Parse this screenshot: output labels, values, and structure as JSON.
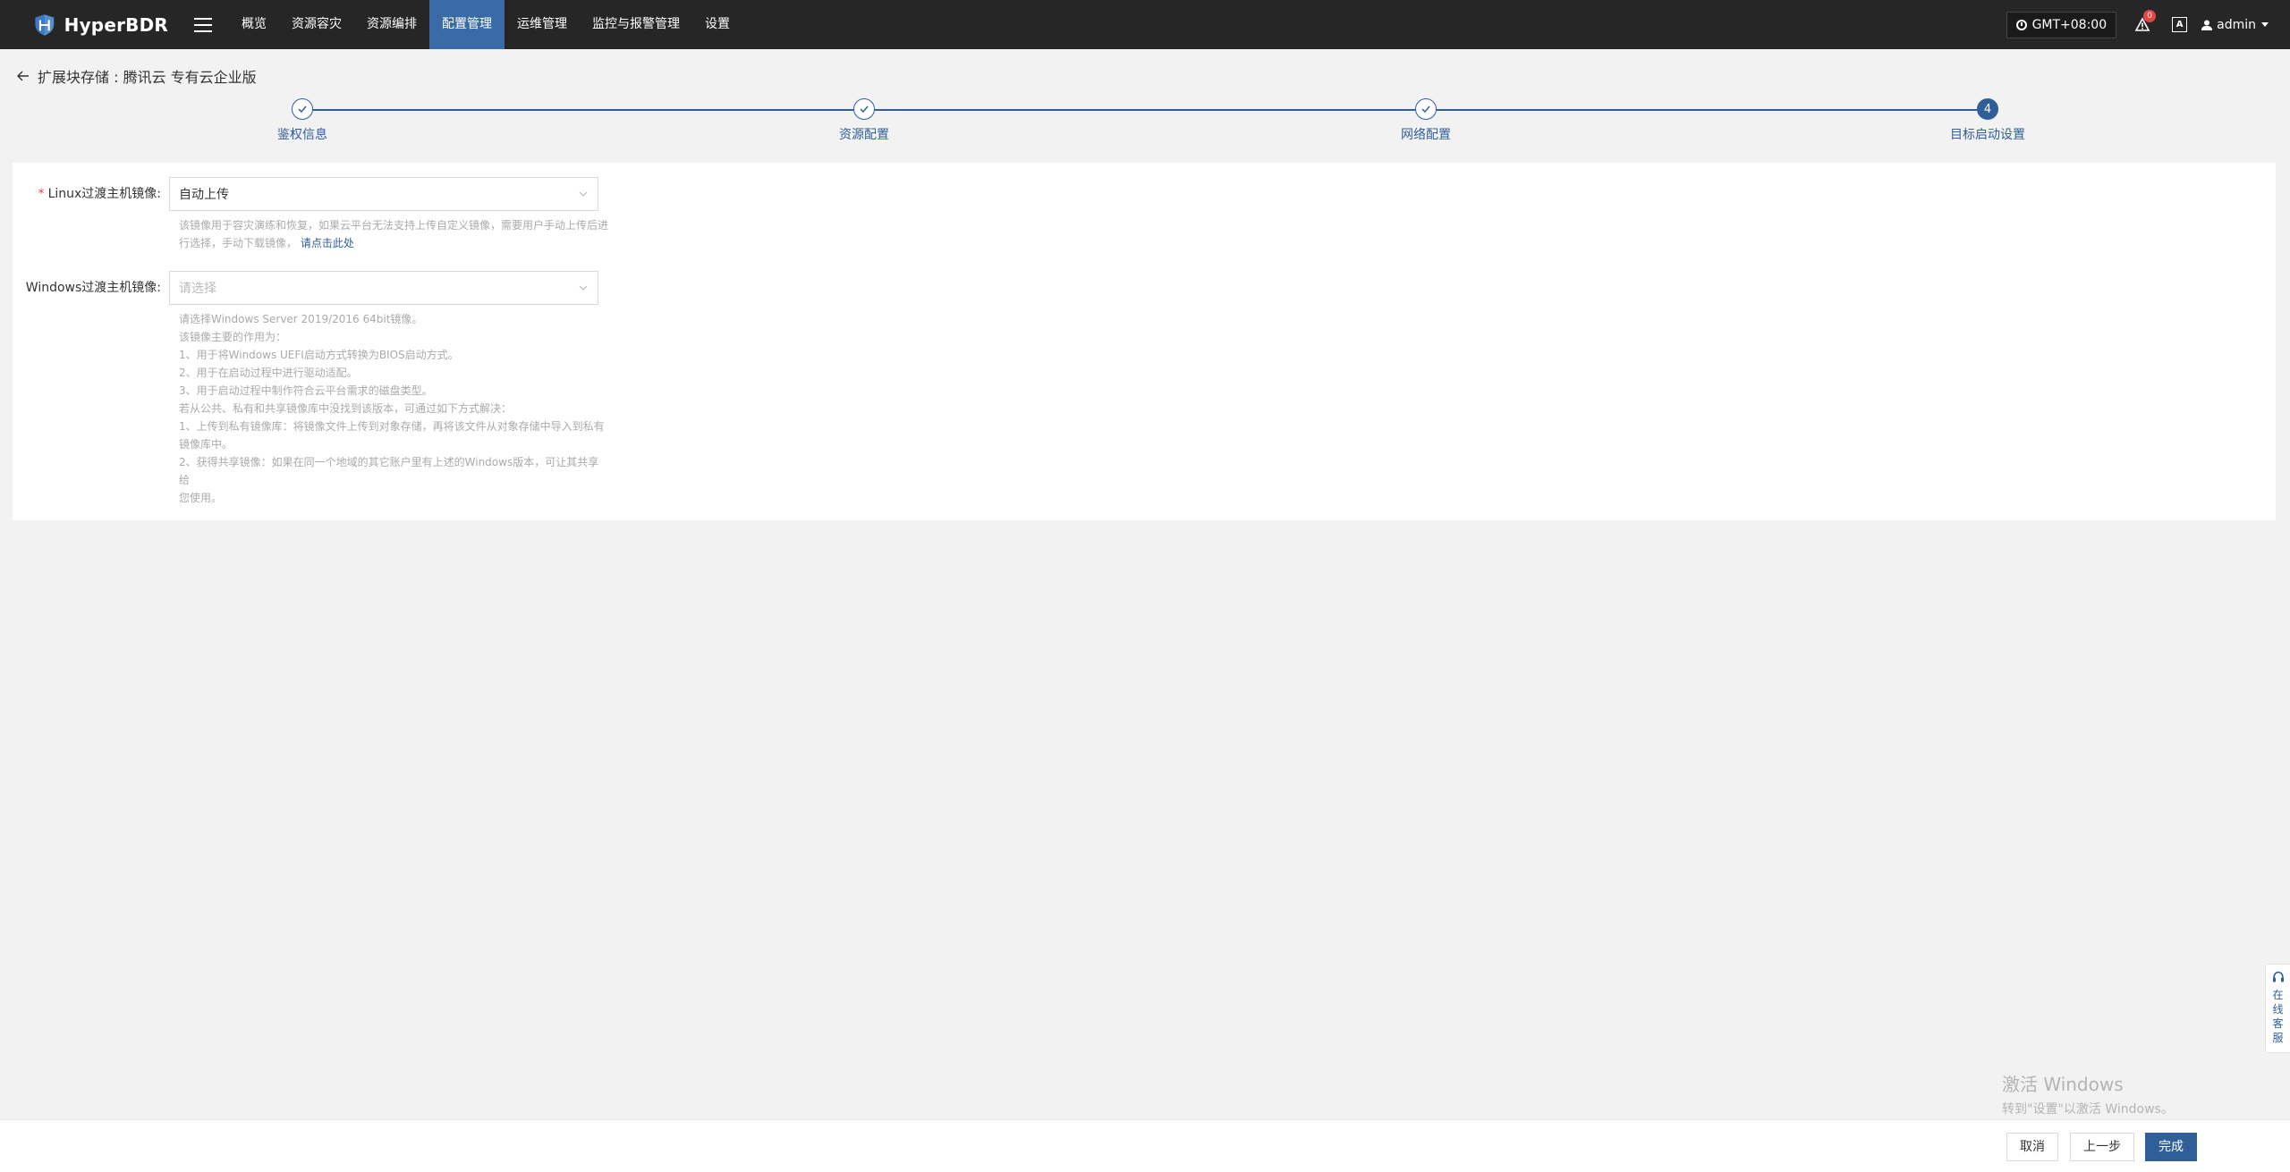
{
  "app": {
    "name": "HyperBDR"
  },
  "nav": {
    "items": [
      {
        "label": "概览",
        "active": false
      },
      {
        "label": "资源容灾",
        "active": false
      },
      {
        "label": "资源编排",
        "active": false
      },
      {
        "label": "配置管理",
        "active": true
      },
      {
        "label": "运维管理",
        "active": false
      },
      {
        "label": "监控与报警管理",
        "active": false
      },
      {
        "label": "设置",
        "active": false
      }
    ]
  },
  "header": {
    "timezone": "GMT+08:00",
    "notification_count": "0",
    "lang_icon_text": "A",
    "user": "admin"
  },
  "page": {
    "title": "扩展块存储 : 腾讯云 专有云企业版"
  },
  "steps": [
    {
      "label": "鉴权信息",
      "status": "done"
    },
    {
      "label": "资源配置",
      "status": "done"
    },
    {
      "label": "网络配置",
      "status": "done"
    },
    {
      "label": "目标启动设置",
      "status": "current",
      "number": "4"
    }
  ],
  "form": {
    "linux": {
      "required_mark": "*",
      "label": "Linux过渡主机镜像:",
      "value": "自动上传",
      "help_lines": [
        "该镜像用于容灾演练和恢复，如果云平台无法支持上传自定义镜像，需要用户手动上传后进",
        "行选择，手动下载镜像，"
      ],
      "help_link": "请点击此处"
    },
    "windows": {
      "label": "Windows过渡主机镜像:",
      "placeholder": "请选择",
      "help_lines": [
        "请选择Windows Server 2019/2016 64bit镜像。",
        "该镜像主要的作用为：",
        "1、用于将Windows UEFI启动方式转换为BIOS启动方式。",
        "2、用于在启动过程中进行驱动适配。",
        "3、用于启动过程中制作符合云平台需求的磁盘类型。",
        "若从公共、私有和共享镜像库中没找到该版本，可通过如下方式解决：",
        "1、上传到私有镜像库：将镜像文件上传到对象存储，再将该文件从对象存储中导入到私有",
        "镜像库中。",
        "2、获得共享镜像：如果在同一个地域的其它账户里有上述的Windows版本，可让其共享给",
        "您使用。"
      ]
    }
  },
  "side_service": {
    "label": "在线客服"
  },
  "watermark": {
    "line1": "激活 Windows",
    "line2": "转到\"设置\"以激活 Windows。"
  },
  "footer": {
    "cancel": "取消",
    "prev": "上一步",
    "finish": "完成"
  }
}
